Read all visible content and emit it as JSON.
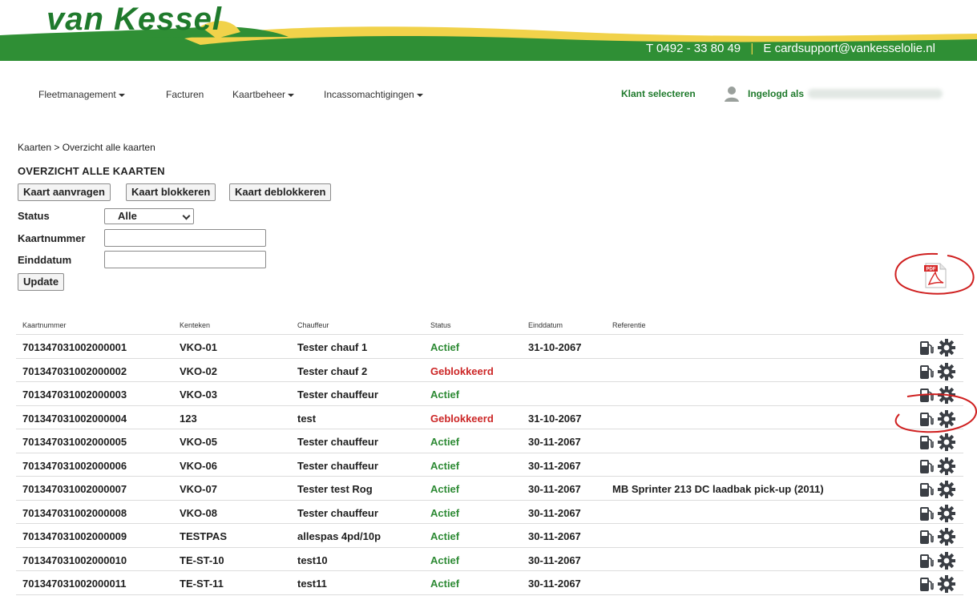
{
  "header": {
    "logo_text": "van Kessel",
    "phone": "T  0492 - 33 80 49",
    "separator": "|",
    "email": "E  cardsupport@vankesselolie.nl",
    "colors": {
      "green": "#2f8f35",
      "gold": "#f1d24a",
      "dark_green": "#1f7a2c"
    }
  },
  "nav": {
    "items": [
      {
        "label": "Fleetmanagement",
        "dropdown": true
      },
      {
        "label": "Facturen",
        "dropdown": false
      },
      {
        "label": "Kaartbeheer",
        "dropdown": true
      },
      {
        "label": "Incassomachtigingen",
        "dropdown": true
      }
    ],
    "select_client": "Klant selecteren",
    "logged_in_label": "Ingelogd als"
  },
  "breadcrumb": "Kaarten > Overzicht alle kaarten",
  "page_title": "OVERZICHT ALLE KAARTEN",
  "actions": {
    "request": "Kaart aanvragen",
    "block": "Kaart blokkeren",
    "unblock": "Kaart deblokkeren"
  },
  "filters": {
    "status_label": "Status",
    "status_value": "Alle",
    "card_label": "Kaartnummer",
    "card_value": "",
    "end_label": "Einddatum",
    "end_value": "",
    "update": "Update"
  },
  "table": {
    "headers": [
      "Kaartnummer",
      "Kenteken",
      "Chauffeur",
      "Status",
      "Einddatum",
      "Referentie"
    ],
    "rows": [
      [
        "701347031002000001",
        "VKO-01",
        "Tester chauf 1",
        "Actief",
        "31-10-2067",
        ""
      ],
      [
        "701347031002000002",
        "VKO-02",
        "Tester chauf 2",
        "Geblokkeerd",
        "",
        ""
      ],
      [
        "701347031002000003",
        "VKO-03",
        "Tester chauffeur",
        "Actief",
        "",
        ""
      ],
      [
        "701347031002000004",
        "123",
        "test",
        "Geblokkeerd",
        "31-10-2067",
        ""
      ],
      [
        "701347031002000005",
        "VKO-05",
        "Tester chauffeur",
        "Actief",
        "30-11-2067",
        ""
      ],
      [
        "701347031002000006",
        "VKO-06",
        "Tester chauffeur",
        "Actief",
        "30-11-2067",
        ""
      ],
      [
        "701347031002000007",
        "VKO-07",
        "Tester test Rog",
        "Actief",
        "30-11-2067",
        "MB Sprinter 213 DC laadbak pick-up (2011)"
      ],
      [
        "701347031002000008",
        "VKO-08",
        "Tester chauffeur",
        "Actief",
        "30-11-2067",
        ""
      ],
      [
        "701347031002000009",
        "TESTPAS",
        "allespas 4pd/10p",
        "Actief",
        "30-11-2067",
        ""
      ],
      [
        "701347031002000010",
        "TE-ST-10",
        "test10",
        "Actief",
        "30-11-2067",
        ""
      ],
      [
        "701347031002000011",
        "TE-ST-11",
        "test11",
        "Actief",
        "30-11-2067",
        ""
      ]
    ],
    "status_colors": {
      "Actief": "#2d8a34",
      "Geblokkeerd": "#cc2626"
    },
    "row_icons": [
      "fuel-pump-icon",
      "gear-icon"
    ]
  },
  "pdf_icon_label": "PDF"
}
